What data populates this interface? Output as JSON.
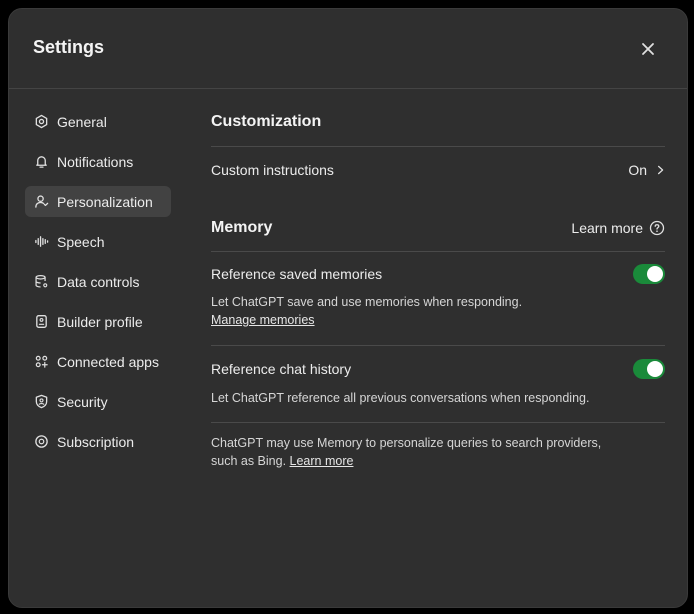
{
  "header": {
    "title": "Settings"
  },
  "sidebar": {
    "items": [
      {
        "label": "General",
        "icon": "gear-icon"
      },
      {
        "label": "Notifications",
        "icon": "bell-icon"
      },
      {
        "label": "Personalization",
        "icon": "person-icon",
        "active": true
      },
      {
        "label": "Speech",
        "icon": "waveform-icon"
      },
      {
        "label": "Data controls",
        "icon": "database-icon"
      },
      {
        "label": "Builder profile",
        "icon": "id-card-icon"
      },
      {
        "label": "Connected apps",
        "icon": "apps-icon"
      },
      {
        "label": "Security",
        "icon": "shield-icon"
      },
      {
        "label": "Subscription",
        "icon": "subscription-icon"
      }
    ]
  },
  "main": {
    "customization": {
      "title": "Customization",
      "custom_instructions_label": "Custom instructions",
      "custom_instructions_value": "On"
    },
    "memory": {
      "title": "Memory",
      "learn_more": "Learn more",
      "saved": {
        "label": "Reference saved memories",
        "desc": "Let ChatGPT save and use memories when responding.",
        "manage_link": "Manage memories",
        "enabled": true
      },
      "history": {
        "label": "Reference chat history",
        "desc": "Let ChatGPT reference all previous conversations when responding.",
        "enabled": true
      },
      "footer_text": "ChatGPT may use Memory to personalize queries to search providers, such as Bing.",
      "footer_link": "Learn more"
    }
  },
  "colors": {
    "toggle_on": "#1a8a3a",
    "dialog_bg": "#2f2f2f",
    "active_nav_bg": "#424242"
  }
}
